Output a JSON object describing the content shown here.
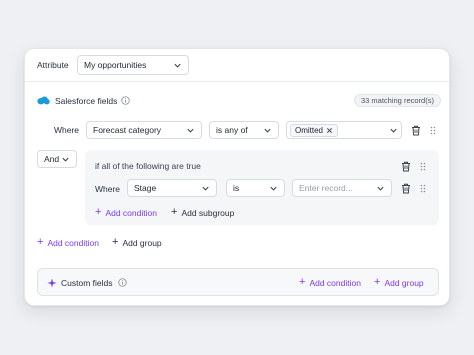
{
  "attribute": {
    "label": "Attribute",
    "value": "My opportunities"
  },
  "salesforce": {
    "title": "Salesforce fields",
    "matching": "33 matching record(s)",
    "row": {
      "where": "Where",
      "field": "Forecast category",
      "operator": "is any of",
      "chip": "Omitted"
    }
  },
  "logic": {
    "value": "And"
  },
  "subgroup": {
    "heading": "if all of the following are true",
    "row": {
      "where": "Where",
      "field": "Stage",
      "operator": "is",
      "placeholder": "Enter record..."
    },
    "add_condition": "Add condition",
    "add_subgroup": "Add subgroup"
  },
  "actions": {
    "add_condition": "Add condition",
    "add_group": "Add group"
  },
  "custom": {
    "title": "Custom fields",
    "add_condition": "Add condition",
    "add_group": "Add group"
  },
  "colors": {
    "accent": "#7c3aed",
    "salesforce": "#1e9bd7"
  }
}
